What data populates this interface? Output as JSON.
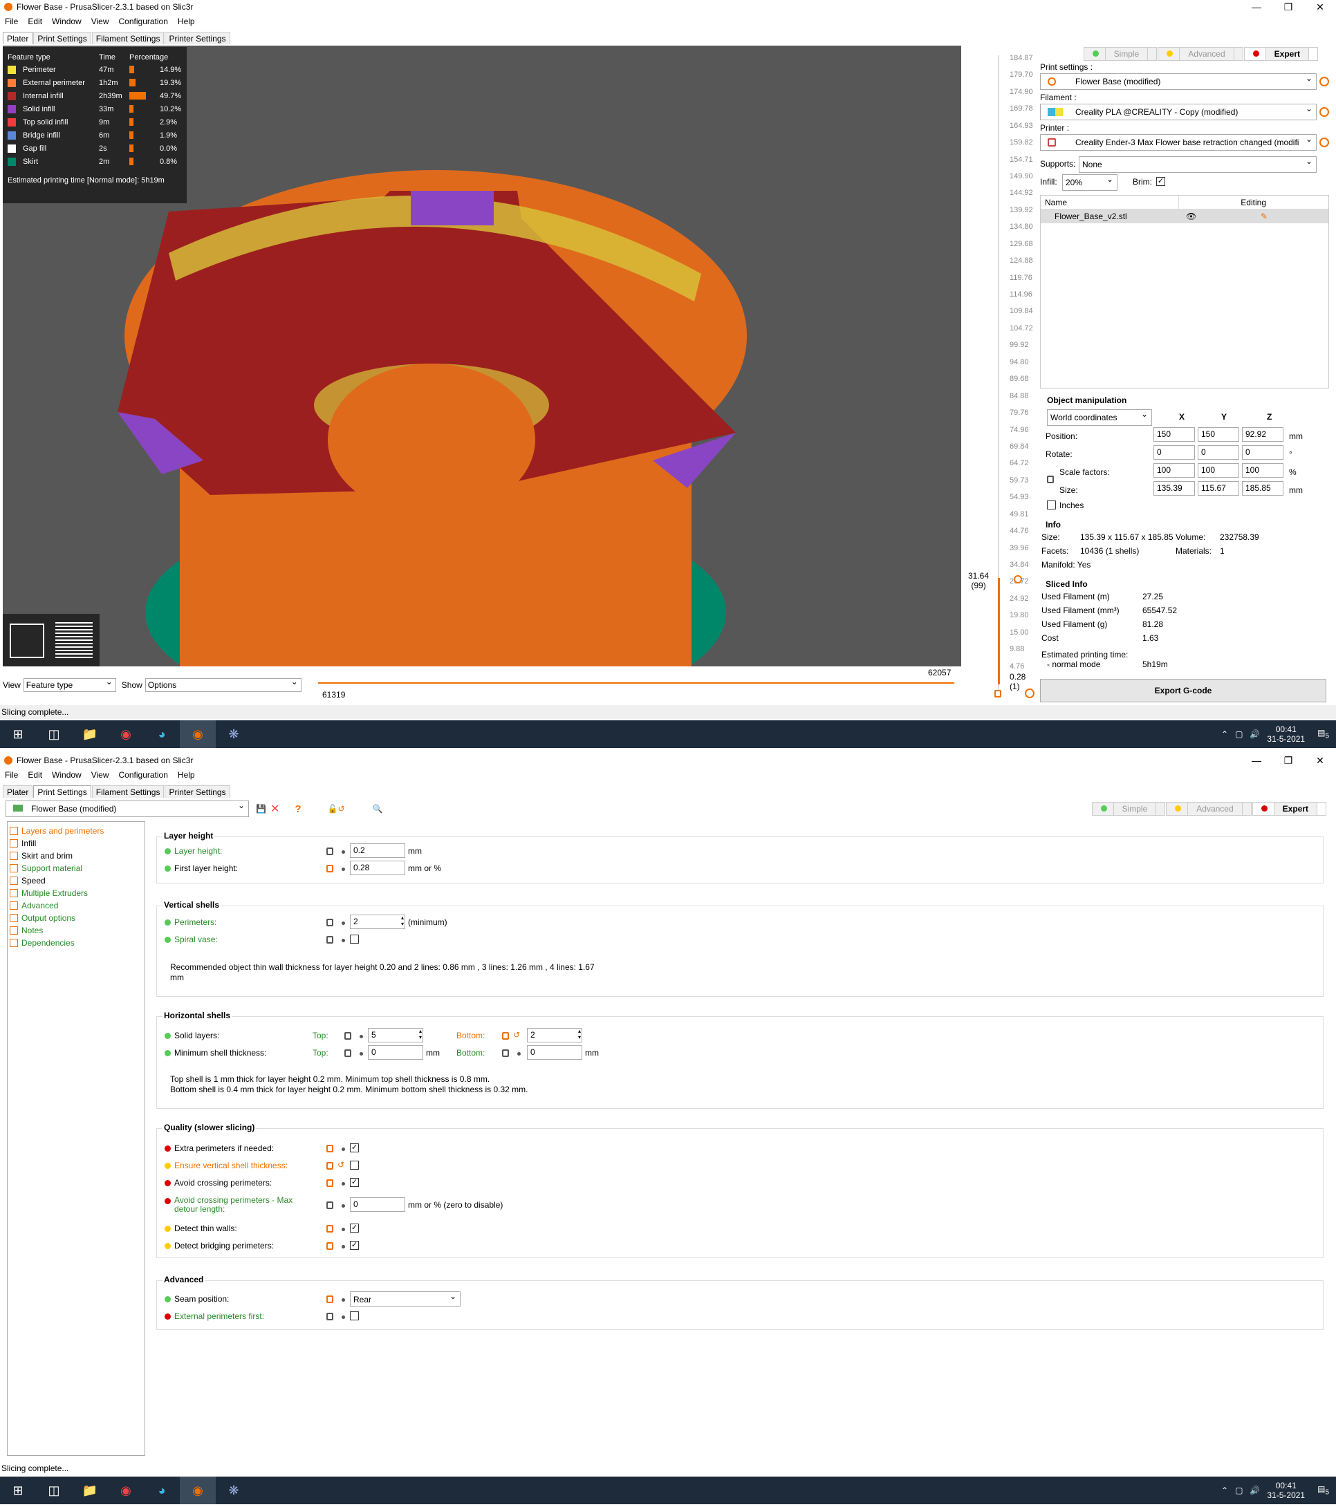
{
  "top_window": {
    "title": "Flower Base - PrusaSlicer-2.3.1 based on Slic3r",
    "menu": [
      "File",
      "Edit",
      "Window",
      "View",
      "Configuration",
      "Help"
    ],
    "tabs": [
      "Plater",
      "Print Settings",
      "Filament Settings",
      "Printer Settings"
    ],
    "legend": {
      "headers": [
        "Feature type",
        "Time",
        "Percentage"
      ],
      "rows": [
        {
          "name": "Perimeter",
          "time": "47m",
          "pct": "14.9%",
          "color": "#f2e13a",
          "frac": 0.149
        },
        {
          "name": "External perimeter",
          "time": "1h2m",
          "pct": "19.3%",
          "color": "#ff7d38",
          "frac": 0.193
        },
        {
          "name": "Internal infill",
          "time": "2h39m",
          "pct": "49.7%",
          "color": "#b02a2a",
          "frac": 0.497
        },
        {
          "name": "Solid infill",
          "time": "33m",
          "pct": "10.2%",
          "color": "#9440c2",
          "frac": 0.102
        },
        {
          "name": "Top solid infill",
          "time": "9m",
          "pct": "2.9%",
          "color": "#f03c3c",
          "frac": 0.029
        },
        {
          "name": "Bridge infill",
          "time": "6m",
          "pct": "1.9%",
          "color": "#5a88d6",
          "frac": 0.019
        },
        {
          "name": "Gap fill",
          "time": "2s",
          "pct": "0.0%",
          "color": "#ffffff",
          "frac": 0.0
        },
        {
          "name": "Skirt",
          "time": "2m",
          "pct": "0.8%",
          "color": "#00876a",
          "frac": 0.008
        }
      ],
      "estimated": "Estimated printing time [Normal mode]:",
      "estimated_value": "5h19m"
    },
    "ruler_ticks": [
      "184.87",
      "179.70",
      "174.90",
      "169.78",
      "164.93",
      "159.82",
      "154.71",
      "149.90",
      "144.92",
      "139.92",
      "134.80",
      "129.68",
      "124.88",
      "119.76",
      "114.96",
      "109.84",
      "104.72",
      "99.92",
      "94.80",
      "89.68",
      "84.88",
      "79.76",
      "74.96",
      "69.84",
      "64.72",
      "59.73",
      "54.93",
      "49.81",
      "44.76",
      "39.96",
      "34.84",
      "29.72",
      "24.92",
      "19.80",
      "15.00",
      "9.88",
      "4.76"
    ],
    "slider_current": "31.64",
    "slider_current_layer": "(99)",
    "slider_min": "0.28",
    "slider_min_layer": "(1)",
    "h_slider_max": "62057",
    "h_slider_min": "61319",
    "view_label": "View",
    "view_value": "Feature type",
    "show_label": "Show",
    "show_value": "Options",
    "modes": [
      "Simple",
      "Advanced",
      "Expert"
    ],
    "print_settings_label": "Print settings :",
    "print_settings_value": "Flower Base (modified)",
    "filament_label": "Filament :",
    "filament_value": "Creality PLA @CREALITY - Copy (modified)",
    "printer_label": "Printer :",
    "printer_value": "Creality Ender-3 Max Flower base retraction changed (modifi",
    "supports_label": "Supports:",
    "supports_value": "None",
    "infill_label": "Infill:",
    "infill_value": "20%",
    "brim_label": "Brim:",
    "objects_headers": [
      "Name",
      "Editing"
    ],
    "object_name": "Flower_Base_v2.stl",
    "om_title": "Object manipulation",
    "coords": "World coordinates",
    "axes": [
      "X",
      "Y",
      "Z"
    ],
    "position_label": "Position:",
    "position": [
      "150",
      "150",
      "92.92"
    ],
    "position_unit": "mm",
    "rotate_label": "Rotate:",
    "rotate": [
      "0",
      "0",
      "0"
    ],
    "rotate_unit": "°",
    "scale_label": "Scale factors:",
    "scale": [
      "100",
      "100",
      "100"
    ],
    "scale_unit": "%",
    "size_label": "Size:",
    "size": [
      "135.39",
      "115.67",
      "185.85"
    ],
    "size_unit": "mm",
    "inches_label": "Inches",
    "info_title": "Info",
    "info_size_label": "Size:",
    "info_size": "135.39 x 115.67 x 185.85",
    "info_volume_label": "Volume:",
    "info_volume": "232758.39",
    "info_facets_label": "Facets:",
    "info_facets": "10436 (1 shells)",
    "info_materials_label": "Materials:",
    "info_materials": "1",
    "info_manifold": "Manifold: Yes",
    "sliced_title": "Sliced Info",
    "sliced": [
      {
        "label": "Used Filament (m)",
        "value": "27.25"
      },
      {
        "label": "Used Filament (mm³)",
        "value": "65547.52"
      },
      {
        "label": "Used Filament (g)",
        "value": "81.28"
      },
      {
        "label": "Cost",
        "value": "1.63"
      }
    ],
    "est_label": "Estimated printing time:",
    "est_mode": "- normal mode",
    "est_value": "5h19m",
    "export_label": "Export G-code",
    "status": "Slicing complete..."
  },
  "taskbar": {
    "time": "00:41",
    "date": "31-5-2021",
    "badge": "5"
  },
  "bottom_window": {
    "title": "Flower Base - PrusaSlicer-2.3.1 based on Slic3r",
    "menu": [
      "File",
      "Edit",
      "Window",
      "View",
      "Configuration",
      "Help"
    ],
    "tabs": [
      "Plater",
      "Print Settings",
      "Filament Settings",
      "Printer Settings"
    ],
    "preset": "Flower Base (modified)",
    "modes": [
      "Simple",
      "Advanced",
      "Expert"
    ],
    "tree": [
      {
        "label": "Layers and perimeters",
        "color": "#f07000"
      },
      {
        "label": "Infill",
        "color": "#000"
      },
      {
        "label": "Skirt and brim",
        "color": "#000"
      },
      {
        "label": "Support material",
        "color": "#2a8a2a"
      },
      {
        "label": "Speed",
        "color": "#000"
      },
      {
        "label": "Multiple Extruders",
        "color": "#2a8a2a"
      },
      {
        "label": "Advanced",
        "color": "#2a8a2a"
      },
      {
        "label": "Output options",
        "color": "#2a8a2a"
      },
      {
        "label": "Notes",
        "color": "#2a8a2a"
      },
      {
        "label": "Dependencies",
        "color": "#2a8a2a"
      }
    ],
    "layer_height_title": "Layer height",
    "layer_height_label": "Layer height:",
    "layer_height": "0.2",
    "layer_height_unit": "mm",
    "first_layer_label": "First layer height:",
    "first_layer": "0.28",
    "first_layer_unit": "mm or %",
    "vshells_title": "Vertical shells",
    "perimeters_label": "Perimeters:",
    "perimeters": "2",
    "perimeters_unit": "(minimum)",
    "spiral_label": "Spiral vase:",
    "vshell_note": "Recommended object thin wall thickness for layer height 0.20 and 2 lines: 0.86 mm , 3 lines: 1.26 mm , 4 lines: 1.67",
    "vshell_note2": "mm",
    "hshells_title": "Horizontal shells",
    "solid_layers_label": "Solid layers:",
    "top_label": "Top:",
    "solid_top": "5",
    "bottom_label": "Bottom:",
    "solid_bottom": "2",
    "min_shell_label": "Minimum shell thickness:",
    "min_top": "0",
    "min_bottom": "0",
    "mm": "mm",
    "hshell_note1": "Top shell is 1 mm thick for layer height 0.2 mm. Minimum top shell thickness is 0.8 mm.",
    "hshell_note2": "Bottom shell is 0.4 mm thick for layer height 0.2 mm. Minimum bottom shell thickness is 0.32 mm.",
    "quality_title": "Quality (slower slicing)",
    "extra_perims": "Extra perimeters if needed:",
    "ensure_vs": "Ensure vertical shell thickness:",
    "avoid_cross": "Avoid crossing perimeters:",
    "avoid_max": "Avoid crossing perimeters - Max",
    "avoid_max2": "detour length:",
    "avoid_max_value": "0",
    "avoid_max_unit": "mm or % (zero to disable)",
    "thin_walls": "Detect thin walls:",
    "bridging": "Detect bridging perimeters:",
    "advanced_title": "Advanced",
    "seam_label": "Seam position:",
    "seam_value": "Rear",
    "ext_first": "External perimeters first:",
    "status": "Slicing complete..."
  }
}
